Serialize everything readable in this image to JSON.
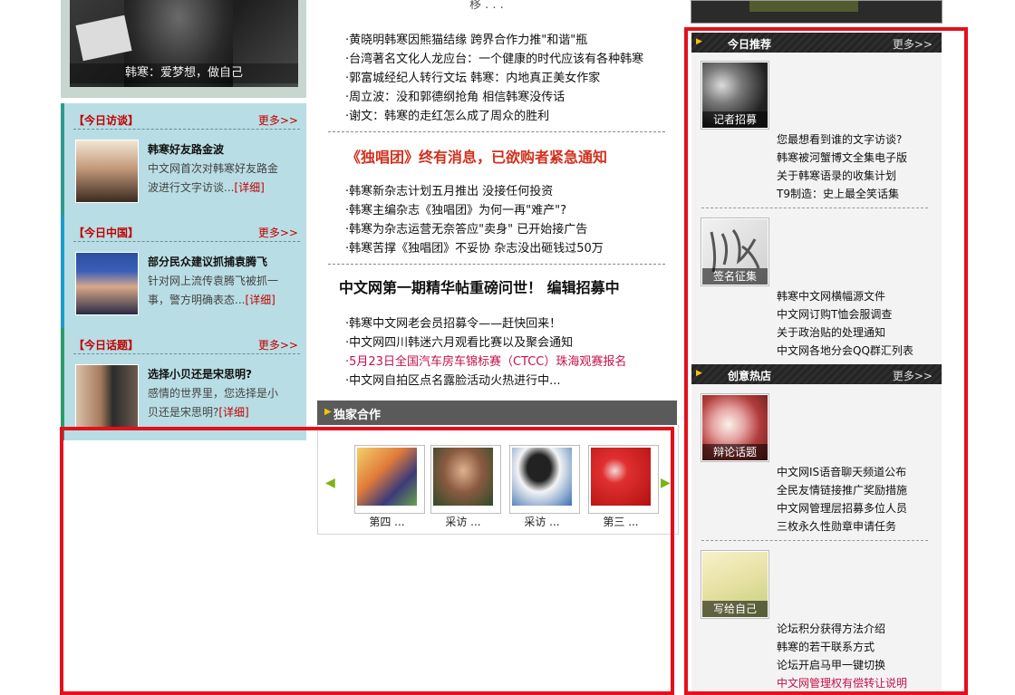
{
  "left": {
    "photo_caption": "韩寒：爱梦想，做自己",
    "boxes": [
      {
        "header": "【今日访谈】",
        "more": "更多>>",
        "title": "韩寒好友路金波",
        "desc": "中文网首次对韩寒好友路金波进行文字访谈...",
        "detail": "[详细]"
      },
      {
        "header": "【今日中国】",
        "more": "更多>>",
        "title": "部分民众建议抓捕袁腾飞",
        "desc": "针对网上流传袁腾飞被抓一事，警方明确表态...",
        "detail": "[详细]"
      },
      {
        "header": "【今日话题】",
        "more": "更多>>",
        "title": "选择小贝还是宋思明?",
        "desc": "感情的世界里，您选择是小贝还是宋思明?",
        "detail": "[详细]"
      }
    ]
  },
  "middle": {
    "top_cut": "移 . . .",
    "group1": [
      "·黄晓明韩寒因熊猫结缘 跨界合作力推\"和谐\"瓶",
      "·台湾著名文化人龙应台：一个健康的时代应该有各种韩寒",
      "·郭富城经纪人转行文坛 韩寒：内地真正美女作家",
      "·周立波：没和郭德纲抢角 相信韩寒没传话",
      "·谢文：韩寒的走红怎么成了周众的胜利"
    ],
    "headline1": "《独唱团》终有消息，已欲购者紧急通知",
    "group2": [
      "·韩寒新杂志计划五月推出 没接任何投资",
      "·韩寒主编杂志《独唱团》为何一再\"难产\"?",
      "·韩寒为杂志运营无奈答应\"卖身\" 已开始接广告",
      "·韩寒苦撑《独唱团》不妥协 杂志没出砸钱过50万"
    ],
    "headline2": "中文网第一期精华帖重磅问世！ 编辑招募中",
    "group3": [
      "·韩寒中文网老会员招募令——赶快回来！",
      "·中文网四川韩迷六月观看比赛以及聚会通知",
      "·5月23日全国汽车房车锦标赛（CTCC）珠海观赛报名",
      "·中文网自拍区点名露脸活动火热进行中..."
    ],
    "partner_title": "独家合作",
    "thumbs": [
      "第四 ...",
      "采访 ...",
      "采访 ...",
      "第三 ..."
    ]
  },
  "right": {
    "section1": {
      "title": "今日推荐",
      "more": "更多>>"
    },
    "section2": {
      "title": "创意热店",
      "more": "更多>>"
    },
    "blocks": [
      {
        "caption": "记者招募",
        "items": [
          "您最想看到谁的文字访谈?",
          "韩寒被河蟹博文全集电子版",
          "关于韩寒语录的收集计划",
          "T9制造：史上最全笑话集"
        ]
      },
      {
        "caption": "签名征集",
        "items": [
          "韩寒中文网横幅源文件",
          "中文网订购T恤会服调查",
          "关于政治贴的处理通知",
          "中文网各地分会QQ群汇列表"
        ]
      },
      {
        "caption": "辩论话题",
        "items": [
          "中文网IS语音聊天频道公布",
          "全民友情链接推广奖励措施",
          "中文网管理层招募多位人员",
          "三枚永久性勋章申请任务"
        ]
      },
      {
        "caption": "写给自己",
        "items": [
          "论坛积分获得方法介绍",
          "韩寒的若干联系方式",
          "论坛开启马甲一键切换",
          "中文网管理权有偿转让说明"
        ]
      }
    ]
  },
  "colors": {
    "highlight": "#e4101b",
    "link_red": "#c00000",
    "pink": "#c4124a",
    "headline_red": "#d1301d"
  }
}
